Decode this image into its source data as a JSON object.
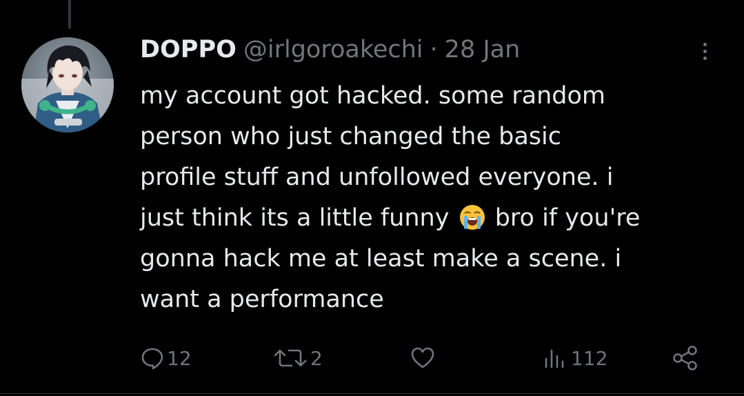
{
  "tweet": {
    "author": {
      "display_name": "DOPPO",
      "handle": "@irlgoroakechi"
    },
    "separator": "·",
    "date": "28 Jan",
    "text_lines": [
      "my account got hacked. some random",
      "person who just changed the basic",
      "profile stuff and unfollowed everyone. i",
      "just think its a little funny",
      "bro if you're",
      "gonna hack me at least make a scene. i",
      "want a performance"
    ],
    "emoji": "loudly-crying-face"
  },
  "actions": {
    "replies": "12",
    "retweets": "2",
    "likes": "",
    "views": "112"
  },
  "icons": {
    "more": "more-dots-vertical-icon",
    "reply": "reply-bubble-icon",
    "retweet": "retweet-icon",
    "like": "heart-icon",
    "views": "views-bar-chart-icon",
    "share": "share-icon"
  },
  "colors": {
    "background": "#000000",
    "text_primary": "#e7e9ea",
    "text_secondary": "#71767b"
  }
}
